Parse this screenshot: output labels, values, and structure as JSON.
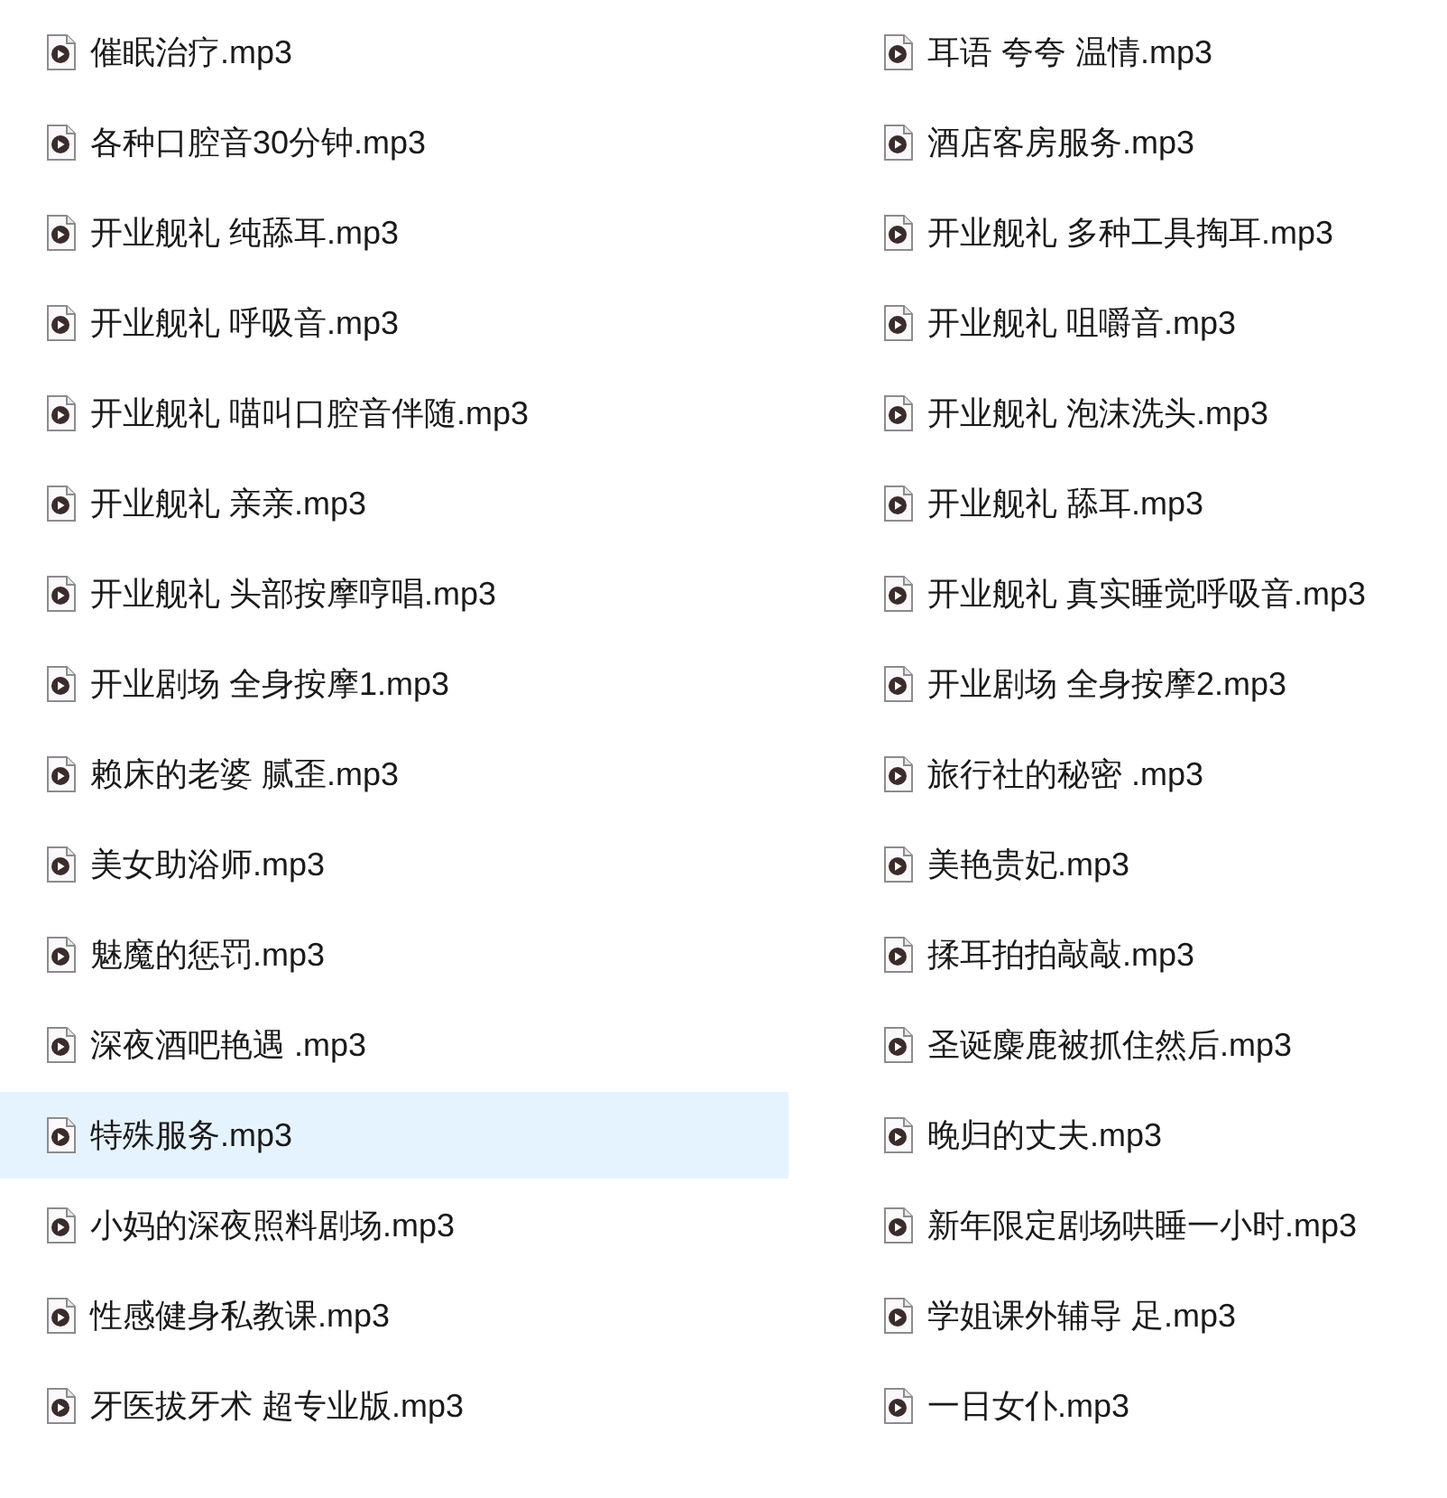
{
  "files": [
    {
      "name": "催眠治疗.mp3",
      "selected": false
    },
    {
      "name": "耳语 夸夸 温情.mp3",
      "selected": false
    },
    {
      "name": "各种口腔音30分钟.mp3",
      "selected": false
    },
    {
      "name": "酒店客房服务.mp3",
      "selected": false
    },
    {
      "name": "开业舰礼 纯舔耳.mp3",
      "selected": false
    },
    {
      "name": "开业舰礼 多种工具掏耳.mp3",
      "selected": false
    },
    {
      "name": "开业舰礼 呼吸音.mp3",
      "selected": false
    },
    {
      "name": "开业舰礼 咀嚼音.mp3",
      "selected": false
    },
    {
      "name": "开业舰礼 喵叫口腔音伴随.mp3",
      "selected": false
    },
    {
      "name": "开业舰礼 泡沫洗头.mp3",
      "selected": false
    },
    {
      "name": "开业舰礼 亲亲.mp3",
      "selected": false
    },
    {
      "name": "开业舰礼 舔耳.mp3",
      "selected": false
    },
    {
      "name": "开业舰礼 头部按摩哼唱.mp3",
      "selected": false
    },
    {
      "name": "开业舰礼 真实睡觉呼吸音.mp3",
      "selected": false
    },
    {
      "name": "开业剧场 全身按摩1.mp3",
      "selected": false
    },
    {
      "name": "开业剧场 全身按摩2.mp3",
      "selected": false
    },
    {
      "name": "赖床的老婆 腻歪.mp3",
      "selected": false
    },
    {
      "name": "旅行社的秘密 .mp3",
      "selected": false
    },
    {
      "name": "美女助浴师.mp3",
      "selected": false
    },
    {
      "name": "美艳贵妃.mp3",
      "selected": false
    },
    {
      "name": "魅魔的惩罚.mp3",
      "selected": false
    },
    {
      "name": "揉耳拍拍敲敲.mp3",
      "selected": false
    },
    {
      "name": "深夜酒吧艳遇 .mp3",
      "selected": false
    },
    {
      "name": "圣诞麋鹿被抓住然后.mp3",
      "selected": false
    },
    {
      "name": "特殊服务.mp3",
      "selected": true
    },
    {
      "name": "晚归的丈夫.mp3",
      "selected": false
    },
    {
      "name": "小妈的深夜照料剧场.mp3",
      "selected": false
    },
    {
      "name": "新年限定剧场哄睡一小时.mp3",
      "selected": false
    },
    {
      "name": "性感健身私教课.mp3",
      "selected": false
    },
    {
      "name": "学姐课外辅导 足.mp3",
      "selected": false
    },
    {
      "name": "牙医拔牙术 超专业版.mp3",
      "selected": false
    },
    {
      "name": "一日女仆.mp3",
      "selected": false
    }
  ]
}
